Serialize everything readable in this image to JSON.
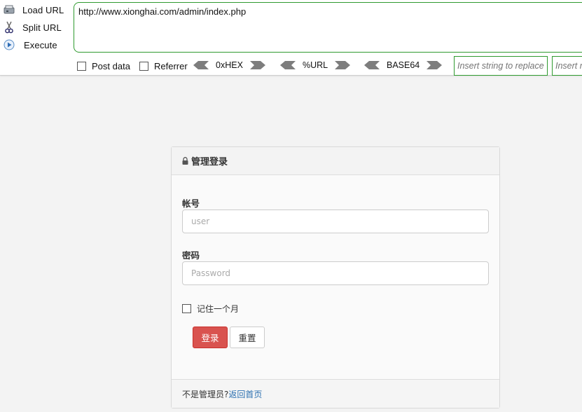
{
  "hackbar": {
    "load_url": "Load URL",
    "split_url": "Split URL",
    "execute": "Execute",
    "url_value": "http://www.xionghai.com/admin/index.php",
    "post_data": "Post data",
    "referrer": "Referrer",
    "hex": "0xHEX",
    "url_enc": "%URL",
    "base64": "BASE64",
    "replace_placeholder": "Insert string to replace",
    "replace_with_placeholder": "Insert r"
  },
  "login": {
    "title": "管理登录",
    "account_label": "帐号",
    "account_placeholder": "user",
    "password_label": "密码",
    "password_placeholder": "Password",
    "remember": "记住一个月",
    "login_button": "登录",
    "reset_button": "重置",
    "footer_text": "不是管理员?",
    "footer_link": "返回首页"
  },
  "colors": {
    "login_button_bg": "#d9534f",
    "link": "#2a6fb0",
    "hackbar_border": "#2f9a2f"
  }
}
